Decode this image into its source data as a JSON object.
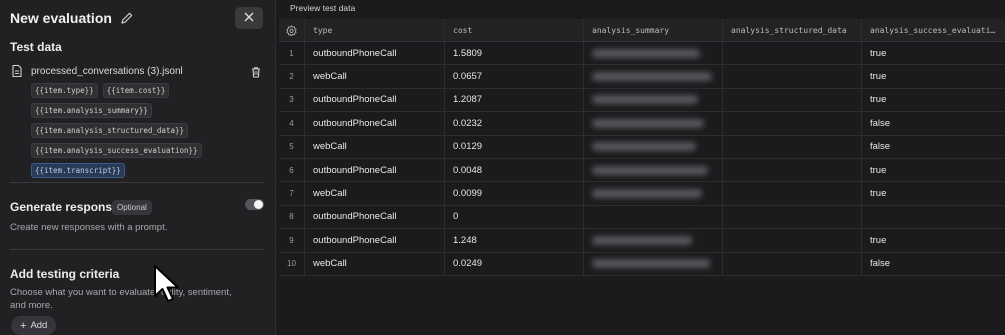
{
  "panel": {
    "title": "New evaluation",
    "test_data_heading": "Test data",
    "file_name": "processed_conversations (3).jsonl",
    "chips": [
      [
        "{{item.type}}",
        "{{item.cost}}"
      ],
      [
        "{{item.analysis_summary}}"
      ],
      [
        "{{item.analysis_structured_data}}"
      ],
      [
        "{{item.analysis_success_evaluation}}"
      ],
      [
        "{{item.transcript}}"
      ]
    ],
    "generate_heading": "Generate responses",
    "optional_badge": "Optional",
    "generate_desc": "Create new responses with a prompt.",
    "criteria_heading": "Add testing criteria",
    "criteria_desc_line1": "Choose what you want to evaluate -",
    "criteria_desc_line1b": "uality, sentiment,",
    "criteria_desc_line2": "and more.",
    "add_label": "Add"
  },
  "preview": {
    "title": "Preview test data",
    "columns": [
      "type",
      "cost",
      "analysis_summary",
      "analysis_structured_data",
      "analysis_success_evaluati…"
    ],
    "rows": [
      {
        "n": "1",
        "type": "outboundPhoneCall",
        "cost": "1.5809",
        "summary_blurred": true,
        "success": "true"
      },
      {
        "n": "2",
        "type": "webCall",
        "cost": "0.0657",
        "summary_blurred": true,
        "success": "true"
      },
      {
        "n": "3",
        "type": "outboundPhoneCall",
        "cost": "1.2087",
        "summary_blurred": true,
        "success": "true"
      },
      {
        "n": "4",
        "type": "outboundPhoneCall",
        "cost": "0.0232",
        "summary_blurred": true,
        "success": "false"
      },
      {
        "n": "5",
        "type": "webCall",
        "cost": "0.0129",
        "summary_blurred": true,
        "success": "false"
      },
      {
        "n": "6",
        "type": "outboundPhoneCall",
        "cost": "0.0048",
        "summary_blurred": true,
        "success": "true"
      },
      {
        "n": "7",
        "type": "webCall",
        "cost": "0.0099",
        "summary_blurred": true,
        "success": "true"
      },
      {
        "n": "8",
        "type": "outboundPhoneCall",
        "cost": "0",
        "summary_blurred": false,
        "success": ""
      },
      {
        "n": "9",
        "type": "outboundPhoneCall",
        "cost": "1.248",
        "summary_blurred": true,
        "success": "true"
      },
      {
        "n": "10",
        "type": "webCall",
        "cost": "0.0249",
        "summary_blurred": true,
        "success": "false"
      }
    ]
  },
  "colors": {
    "panel_bg": "#212123",
    "table_bg": "#1b1b1d",
    "selected_chip": "#2a3a55"
  },
  "icons": {
    "edit": "pencil-icon",
    "close": "close-icon",
    "file": "file-icon",
    "delete": "trash-icon",
    "settings": "gear-icon",
    "cursor": "mouse-pointer-icon"
  }
}
